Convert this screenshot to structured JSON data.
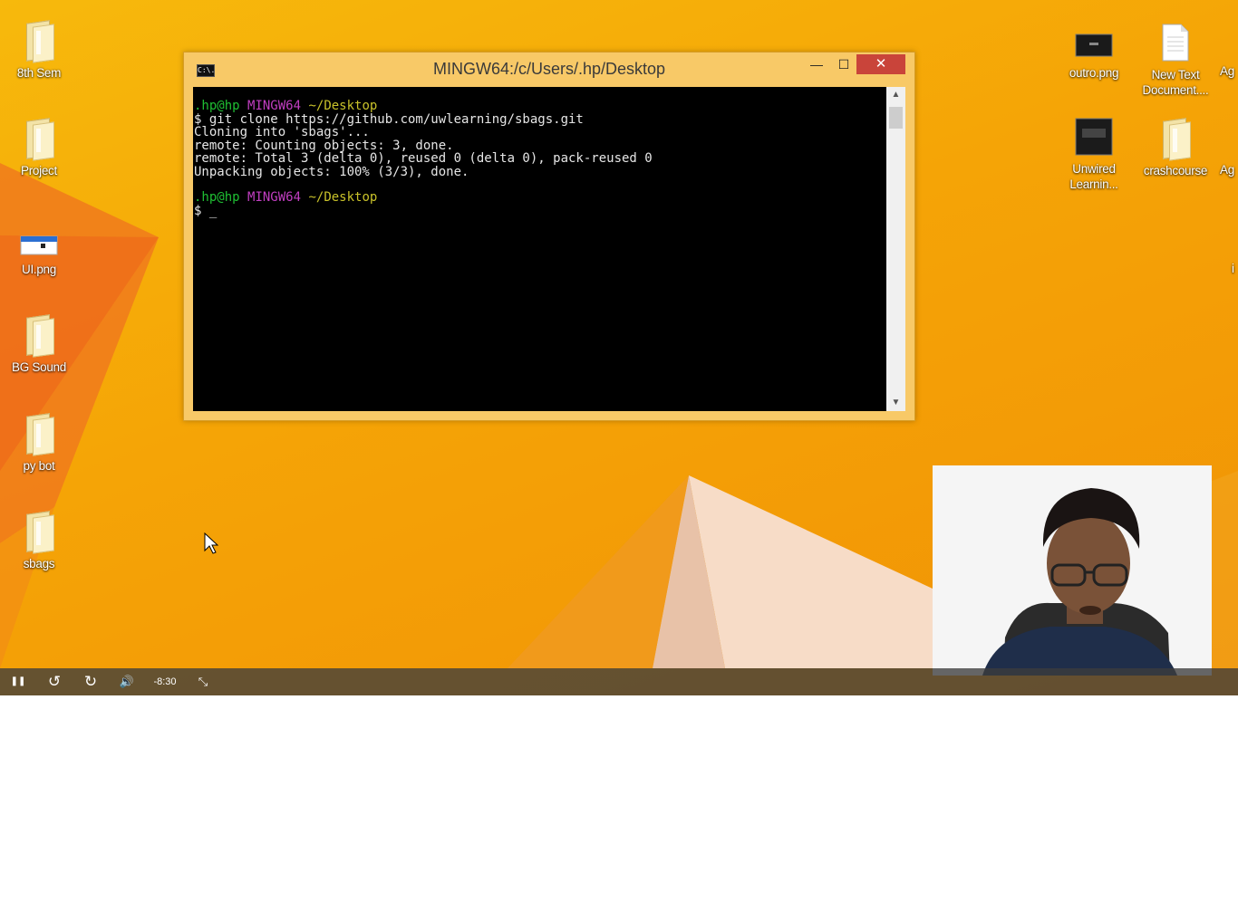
{
  "desktop": {
    "left_icons": [
      {
        "label": "8th Sem",
        "icon": "folder-icon"
      },
      {
        "label": "Project",
        "icon": "folder-icon"
      },
      {
        "label": "UI.png",
        "icon": "image-file-icon"
      },
      {
        "label": "BG Sound",
        "icon": "folder-icon"
      },
      {
        "label": "py bot",
        "icon": "folder-icon"
      },
      {
        "label": "sbags",
        "icon": "folder-icon"
      }
    ],
    "right_icons": [
      {
        "label": "outro.png",
        "icon": "image-file-icon"
      },
      {
        "label": "New Text Document....",
        "icon": "text-file-icon"
      },
      {
        "label": "Unwired Learnin...",
        "icon": "image-file-icon"
      },
      {
        "label": "crashcourse",
        "icon": "folder-icon"
      }
    ],
    "edge_labels": [
      "Ag",
      "Ag",
      "i"
    ]
  },
  "window": {
    "title": "MINGW64:/c/Users/.hp/Desktop",
    "icon_text": "C:\\.",
    "minimize": "—",
    "maximize": "☐",
    "close": "✕"
  },
  "terminal": {
    "prompt1": {
      "user": ".hp@hp",
      "shell": "MINGW64",
      "path": "~/Desktop"
    },
    "lines": [
      "$ git clone https://github.com/uwlearning/sbags.git",
      "Cloning into 'sbags'...",
      "remote: Counting objects: 3, done.",
      "remote: Total 3 (delta 0), reused 0 (delta 0), pack-reused 0",
      "Unpacking objects: 100% (3/3), done."
    ],
    "prompt2": {
      "user": ".hp@hp",
      "shell": "MINGW64",
      "path": "~/Desktop"
    },
    "input_line": "$ _"
  },
  "player": {
    "pause": "❚❚",
    "rewind": "↺",
    "forward": "↻",
    "volume": "🔊",
    "time_remaining": "-8:30",
    "exit_fullscreen": "⤡"
  },
  "colors": {
    "desktop_orange": "#f5a406",
    "terminal_bg": "#000000",
    "prompt_green": "#1fbf33",
    "prompt_magenta": "#c13ec1",
    "prompt_yellow": "#c9c22a",
    "close_red": "#c9443a"
  }
}
